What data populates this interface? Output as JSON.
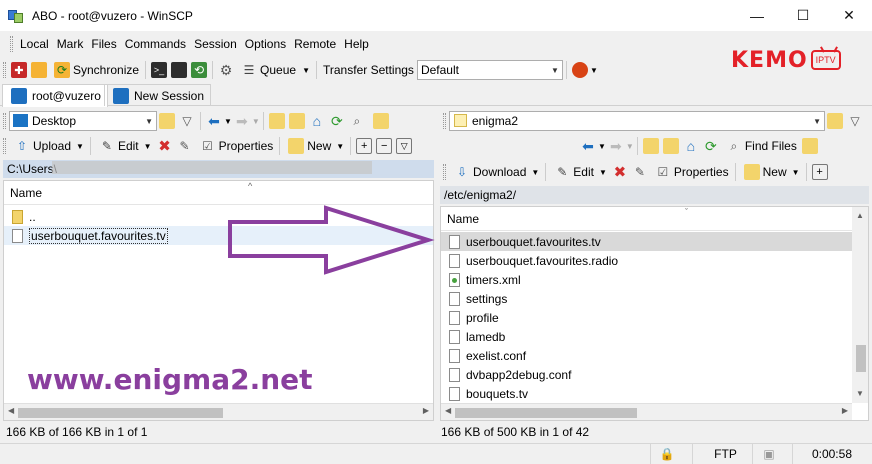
{
  "window": {
    "title": "ABO - root@vuzero - WinSCP",
    "controls": [
      "—",
      "☐",
      "✕"
    ]
  },
  "menu": [
    "Local",
    "Mark",
    "Files",
    "Commands",
    "Session",
    "Options",
    "Remote",
    "Help"
  ],
  "toolbar1": {
    "synchronize": "Synchronize",
    "queue": "Queue",
    "transfer_settings_label": "Transfer Settings",
    "transfer_settings_value": "Default"
  },
  "brand": {
    "name": "KEMO",
    "badge": "IPTV",
    "color": "#e32128"
  },
  "tabs": [
    {
      "label": "root@vuzero",
      "active": true
    },
    {
      "label": "New Session",
      "active": false
    }
  ],
  "left": {
    "location": "Desktop",
    "toolbar": {
      "upload": "Upload",
      "edit": "Edit",
      "properties": "Properties",
      "new": "New"
    },
    "path": "C:\\Users\\",
    "column_name": "Name",
    "files": [
      {
        "name": "..",
        "type": "parent"
      },
      {
        "name": "userbouquet.favourites.tv",
        "type": "file",
        "focused": true
      }
    ],
    "status": "166 KB of 166 KB in 1 of 1"
  },
  "right": {
    "location": "enigma2",
    "toolbar": {
      "find_files": "Find Files",
      "download": "Download",
      "edit": "Edit",
      "properties": "Properties",
      "new": "New"
    },
    "path": "/etc/enigma2/",
    "column_name": "Name",
    "files": [
      {
        "name": "userbouquet.favourites.tv",
        "type": "file",
        "selected": true
      },
      {
        "name": "userbouquet.favourites.radio",
        "type": "file"
      },
      {
        "name": "timers.xml",
        "type": "xml"
      },
      {
        "name": "settings",
        "type": "file"
      },
      {
        "name": "profile",
        "type": "file"
      },
      {
        "name": "lamedb",
        "type": "file"
      },
      {
        "name": "exelist.conf",
        "type": "file"
      },
      {
        "name": "dvbapp2debug.conf",
        "type": "file"
      },
      {
        "name": "bouquets.tv",
        "type": "file"
      }
    ],
    "status": "166 KB of 500 KB in 1 of 42"
  },
  "statusbar": {
    "protocol": "FTP",
    "elapsed": "0:00:58"
  },
  "watermark": "www.enigma2.net",
  "arrow_color": "#8a3f9e"
}
